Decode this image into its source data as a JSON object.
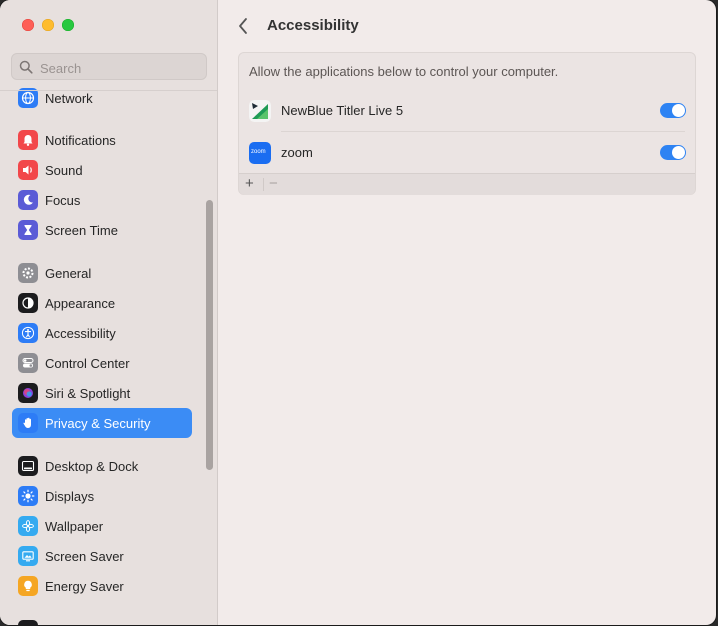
{
  "window": {
    "title": "Accessibility"
  },
  "search": {
    "placeholder": "Search"
  },
  "sidebar": {
    "items": [
      {
        "label": "Network",
        "icon": "globe-icon",
        "color": "#2d7cf6"
      },
      {
        "label": "Notifications",
        "icon": "bell-icon",
        "color": "#f2474a"
      },
      {
        "label": "Sound",
        "icon": "speaker-icon",
        "color": "#f2474a"
      },
      {
        "label": "Focus",
        "icon": "moon-icon",
        "color": "#5b5bd6"
      },
      {
        "label": "Screen Time",
        "icon": "hourglass-icon",
        "color": "#5b5bd6"
      },
      {
        "label": "General",
        "icon": "gear-icon",
        "color": "#8e8e93"
      },
      {
        "label": "Appearance",
        "icon": "appearance-icon",
        "color": "#1c1c1e"
      },
      {
        "label": "Accessibility",
        "icon": "accessibility-icon",
        "color": "#2d7cf6"
      },
      {
        "label": "Control Center",
        "icon": "toggles-icon",
        "color": "#8e8e93"
      },
      {
        "label": "Siri & Spotlight",
        "icon": "siri-icon",
        "color": "#1c1c1e"
      },
      {
        "label": "Privacy & Security",
        "icon": "hand-icon",
        "color": "#2d7cf6",
        "selected": true
      },
      {
        "label": "Desktop & Dock",
        "icon": "dock-icon",
        "color": "#1c1c1e"
      },
      {
        "label": "Displays",
        "icon": "sun-icon",
        "color": "#2d7cf6"
      },
      {
        "label": "Wallpaper",
        "icon": "flower-icon",
        "color": "#35aaf0"
      },
      {
        "label": "Screen Saver",
        "icon": "screensaver-icon",
        "color": "#35aaf0"
      },
      {
        "label": "Energy Saver",
        "icon": "bulb-icon",
        "color": "#f5a623"
      }
    ]
  },
  "main": {
    "description": "Allow the applications below to control your computer.",
    "apps": [
      {
        "name": "NewBlue Titler Live 5",
        "icon": "newblue-icon",
        "enabled": true
      },
      {
        "name": "zoom",
        "icon": "zoom-icon",
        "icon_text": "zoom",
        "enabled": true
      }
    ],
    "add_label": "+",
    "remove_label": "−"
  },
  "colors": {
    "accent": "#3b8cf5",
    "toggle_on": "#2e83f3"
  }
}
